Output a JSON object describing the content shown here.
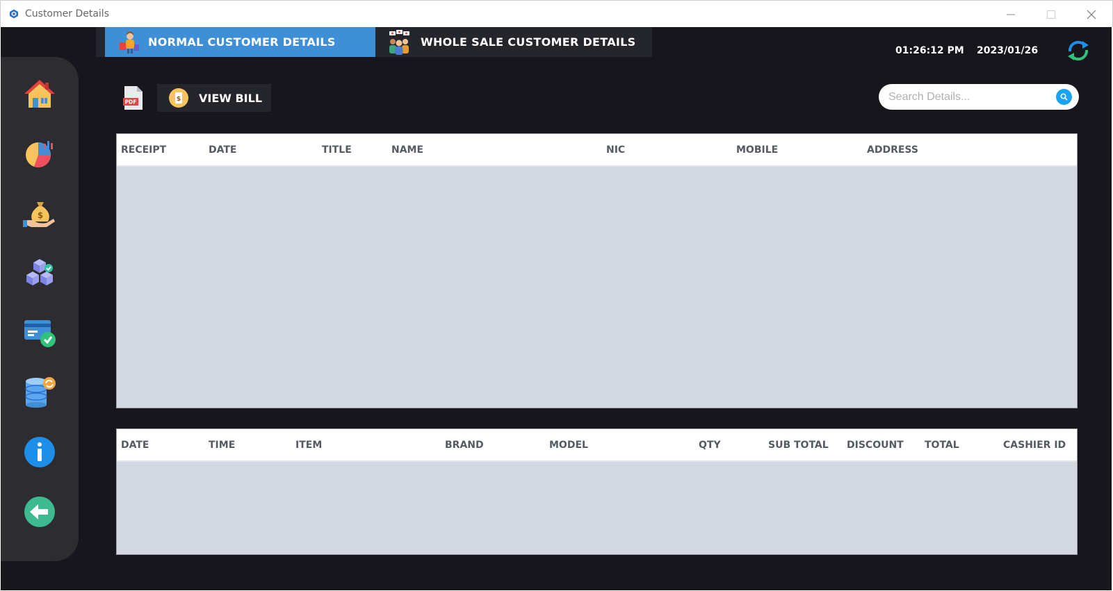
{
  "window": {
    "title": "Customer Details"
  },
  "tabs": [
    {
      "label": "NORMAL CUSTOMER DETAILS",
      "active": true
    },
    {
      "label": "WHOLE SALE CUSTOMER DETAILS",
      "active": false
    }
  ],
  "clock": {
    "time": "01:26:12 PM",
    "date": "2023/01/26"
  },
  "toolbar": {
    "view_bill_label": "VIEW BILL",
    "pdf_label": "PDF"
  },
  "search": {
    "placeholder": "Search Details...",
    "value": ""
  },
  "customer_table": {
    "columns": [
      "RECEIPT",
      "DATE",
      "TITLE",
      "NAME",
      "NIC",
      "MOBILE",
      "ADDRESS"
    ],
    "rows": []
  },
  "items_table": {
    "columns": [
      "DATE",
      "TIME",
      "ITEM",
      "BRAND",
      "MODEL",
      "QTY",
      "SUB TOTAL",
      "DISCOUNT",
      "TOTAL",
      "CASHIER ID"
    ],
    "rows": []
  },
  "sidebar": {
    "items": [
      {
        "icon": "home-icon"
      },
      {
        "icon": "pie-chart-icon"
      },
      {
        "icon": "money-bag-icon"
      },
      {
        "icon": "cubes-icon"
      },
      {
        "icon": "card-check-icon"
      },
      {
        "icon": "database-icon"
      },
      {
        "icon": "info-icon"
      },
      {
        "icon": "back-arrow-icon"
      }
    ]
  },
  "colors": {
    "background": "#16161c",
    "sidebar": "#2c2c31",
    "active_tab": "#3e8fd6",
    "inactive_tab": "#25252c",
    "table_body": "#d4d8e1",
    "search_accent": "#1aa3f0"
  }
}
